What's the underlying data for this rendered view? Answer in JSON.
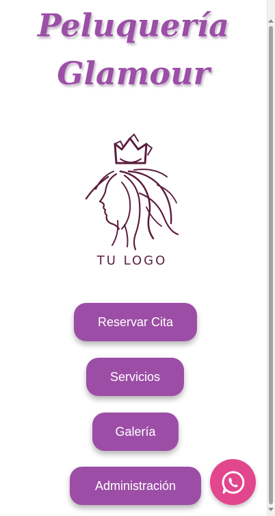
{
  "header": {
    "title_line1": "Peluquería",
    "title_line2": "Glamour"
  },
  "logo": {
    "icon": "crowned-woman-profile-icon",
    "text": "TU LOGO"
  },
  "menu": {
    "reservar_label": "Reservar Cita",
    "servicios_label": "Servicios",
    "galeria_label": "Galería",
    "admin_label": "Administración"
  },
  "fab": {
    "icon": "whatsapp-icon"
  },
  "colors": {
    "title": "#9b4fa6",
    "button": "#9c4ea6",
    "button_text": "#ffffff",
    "logo": "#5b1d3d",
    "whatsapp": "#e2468d"
  }
}
